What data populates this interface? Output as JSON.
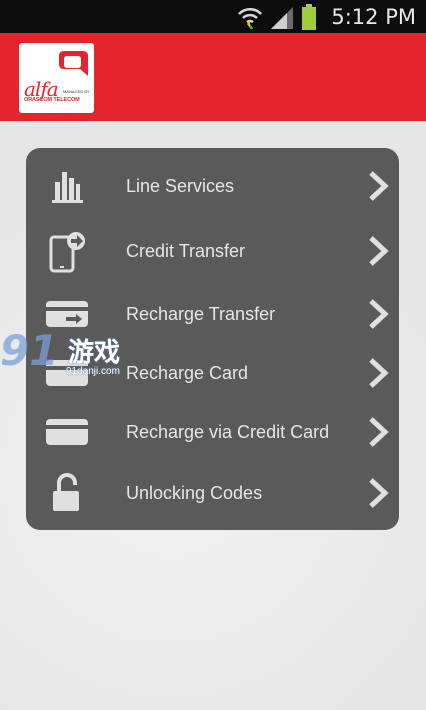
{
  "status_bar": {
    "time": "5:12 PM",
    "icons": [
      "wifi-icon",
      "signal-icon",
      "battery-icon"
    ]
  },
  "header": {
    "logo_word": "alfa",
    "logo_tag_1": "MANAGED BY",
    "logo_tag_2": "ORASCOM TELECOM",
    "brand_color": "#e3262e"
  },
  "menu": {
    "items": [
      {
        "label": "Line Services",
        "icon": "bar-chart-icon"
      },
      {
        "label": "Credit Transfer",
        "icon": "phone-transfer-icon"
      },
      {
        "label": "Recharge Transfer",
        "icon": "card-transfer-icon"
      },
      {
        "label": "Recharge Card",
        "icon": "card-icon"
      },
      {
        "label": "Recharge via Credit Card",
        "icon": "credit-card-icon"
      },
      {
        "label": "Unlocking Codes",
        "icon": "padlock-icon"
      }
    ]
  },
  "watermark": {
    "number": "91",
    "chinese": "游戏",
    "url": "91danji.com"
  }
}
